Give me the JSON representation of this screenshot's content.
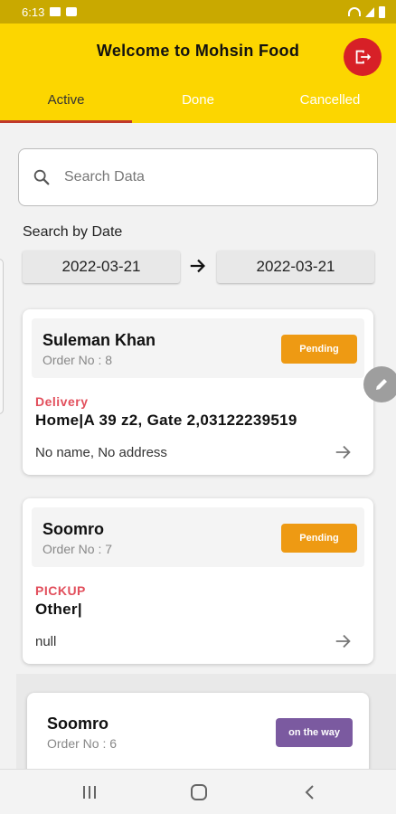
{
  "status_bar": {
    "time": "6:13"
  },
  "header": {
    "title": "Welcome to Mohsin Food"
  },
  "tabs": [
    {
      "label": "Active"
    },
    {
      "label": "Done"
    },
    {
      "label": "Cancelled"
    }
  ],
  "search": {
    "placeholder": "Search Data",
    "value": ""
  },
  "date_filter": {
    "label": "Search by Date",
    "from": "2022-03-21",
    "to": "2022-03-21"
  },
  "orders": [
    {
      "name": "Suleman Khan",
      "order_no": "Order No : 8",
      "status": "Pending",
      "status_color": "#ee9a13",
      "type": "Delivery",
      "address": "Home|A 39 z2, Gate 2,03122239519",
      "note": "No name, No address"
    },
    {
      "name": "Soomro",
      "order_no": "Order No : 7",
      "status": "Pending",
      "status_color": "#ee9a13",
      "type": "PICKUP",
      "address": "Other|",
      "note": "null"
    },
    {
      "name": "Soomro",
      "order_no": "Order No : 6",
      "status": "on the way",
      "status_color": "#7b5aa0"
    }
  ],
  "colors": {
    "primary": "#fcd600",
    "accent_red": "#d72027",
    "type_label": "#e24f5c"
  }
}
